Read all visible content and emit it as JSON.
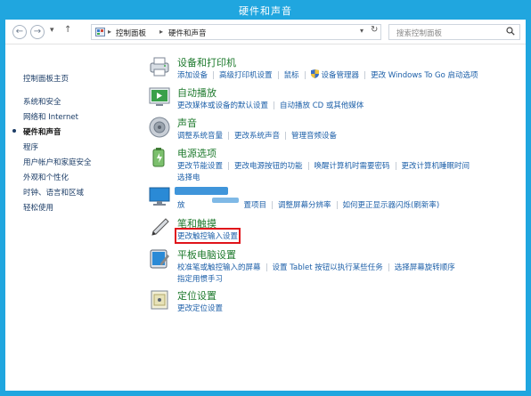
{
  "window": {
    "title": "硬件和声音"
  },
  "nav": {
    "back": "←",
    "forward": "→",
    "history": "▾",
    "up": "↑"
  },
  "address": {
    "crumbs": [
      "控制面板",
      "硬件和声音"
    ],
    "refresh": "↻"
  },
  "search": {
    "placeholder": "搜索控制面板"
  },
  "sidebar": {
    "items": [
      {
        "label": "控制面板主页"
      },
      {
        "label": "系统和安全"
      },
      {
        "label": "网络和 Internet"
      },
      {
        "label": "硬件和声音"
      },
      {
        "label": "程序"
      },
      {
        "label": "用户帐户和家庭安全"
      },
      {
        "label": "外观和个性化"
      },
      {
        "label": "时钟、语言和区域"
      },
      {
        "label": "轻松使用"
      }
    ]
  },
  "categories": {
    "devices": {
      "title": "设备和打印机",
      "links": [
        "添加设备",
        "高级打印机设置",
        "鼠标",
        "设备管理器",
        "更改 Windows To Go 启动选项"
      ]
    },
    "autoplay": {
      "title": "自动播放",
      "links": [
        "更改媒体或设备的默认设置",
        "自动播放 CD 或其他媒体"
      ]
    },
    "sound": {
      "title": "声音",
      "links": [
        "调整系统音量",
        "更改系统声音",
        "管理音频设备"
      ]
    },
    "power": {
      "title": "电源选项",
      "links": [
        "更改节能设置",
        "更改电源按钮的功能",
        "唤醒计算机时需要密码",
        "更改计算机睡眠时间"
      ],
      "links2": [
        "选择电"
      ]
    },
    "display": {
      "title": "显示",
      "links": [
        "放",
        "置项目",
        "调整屏幕分辨率",
        "如何更正显示器闪烁(刷新率)"
      ]
    },
    "pen": {
      "title": "笔和触摸",
      "links": [
        "更改触控输入设置"
      ]
    },
    "tablet": {
      "title": "平板电脑设置",
      "links": [
        "校准笔或触控输入的屏幕",
        "设置 Tablet 按钮以执行某些任务",
        "选择屏幕旋转顺序"
      ],
      "links2": [
        "指定用惯手习"
      ]
    },
    "location": {
      "title": "定位设置",
      "links": [
        "更改定位设置"
      ]
    }
  },
  "colors": {
    "accent": "#20a6df",
    "heading": "#1e7a2d",
    "link": "#1c5fa8",
    "highlight": "#e0131a"
  }
}
